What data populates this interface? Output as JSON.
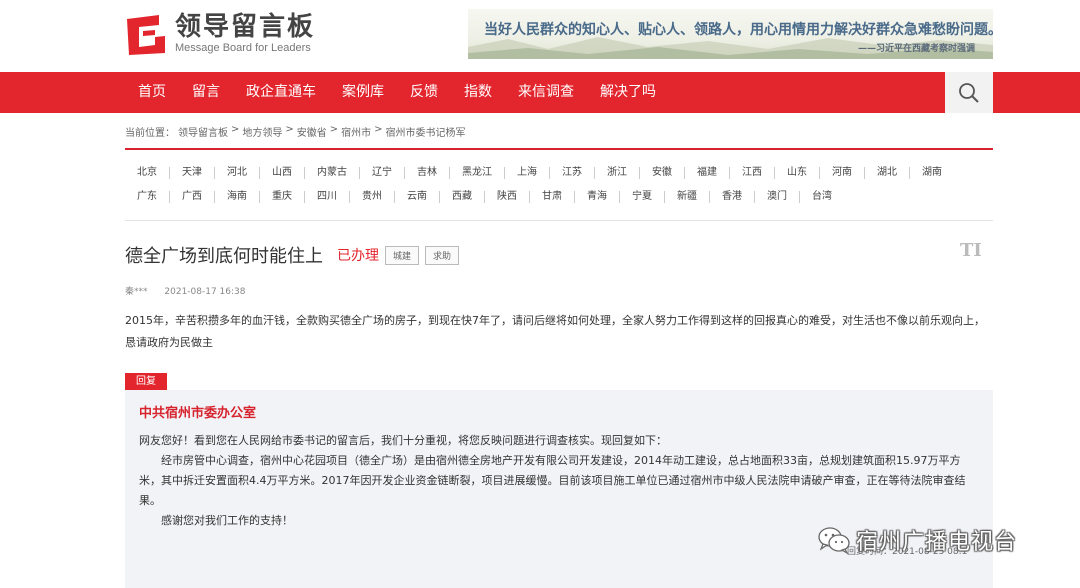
{
  "logo": {
    "title": "领导留言板",
    "subtitle": "Message Board for Leaders",
    "brand_color": "#e3262e"
  },
  "banner": {
    "slogan": "当好人民群众的知心人、贴心人、领路人，用心用情用力解决好群众急难愁盼问题。",
    "author": "——习近平在西藏考察时强调"
  },
  "nav": {
    "items": [
      "首页",
      "留言",
      "政企直通车",
      "案例库",
      "反馈",
      "指数",
      "来信调查",
      "解决了吗"
    ],
    "search_icon": "search-icon"
  },
  "breadcrumb": [
    "当前位置：",
    "领导留言板",
    ">",
    "地方领导",
    ">",
    "安徽省",
    ">",
    "宿州市",
    ">",
    "宿州市委书记杨军"
  ],
  "regions": {
    "row1": [
      "北京",
      "天津",
      "河北",
      "山西",
      "内蒙古",
      "辽宁",
      "吉林",
      "黑龙江",
      "上海",
      "江苏",
      "浙江",
      "安徽",
      "福建",
      "江西",
      "山东",
      "河南",
      "湖北",
      "湖南"
    ],
    "row2": [
      "广东",
      "广西",
      "海南",
      "重庆",
      "四川",
      "贵州",
      "云南",
      "西藏",
      "陕西",
      "甘肃",
      "青海",
      "宁夏",
      "新疆",
      "香港",
      "澳门",
      "台湾"
    ]
  },
  "message": {
    "title": "德全广场到底何时能住上",
    "status": "已办理",
    "tags": [
      "城建",
      "求助"
    ],
    "font_toggle": "TI",
    "author": "秦***",
    "time": "2021-08-17 16:38",
    "body": "2015年，辛苦积攒多年的血汗钱，全款购买德全广场的房子，到现在快7年了，请问后继将如何处理，全家人努力工作得到这样的回报真心的难受，对生活也不像以前乐观向上，恳请政府为民做主"
  },
  "reply": {
    "tag": "回复",
    "org": "中共宿州市委办公室",
    "greeting": "网友您好！看到您在人民网给市委书记的留言后，我们十分重视，将您反映问题进行调查核实。现回复如下：",
    "paragraph": "经市房管中心调查，宿州中心花园项目（德全广场）是由宿州德全房地产开发有限公司开发建设，2014年动工建设，总占地面积33亩，总规划建筑面积15.97万平方米，其中拆迁安置面积4.4万平方米。2017年因开发企业资金链断裂，项目进展缓慢。目前该项目施工单位已通过宿州市中级人民法院申请破产审查，正在等待法院审查结果。",
    "thanks": "感谢您对我们工作的支持！",
    "date": "回复时间：2021-08-25 08:1"
  },
  "watermark": {
    "text": "宿州广播电视台",
    "icon": "wechat-icon"
  }
}
